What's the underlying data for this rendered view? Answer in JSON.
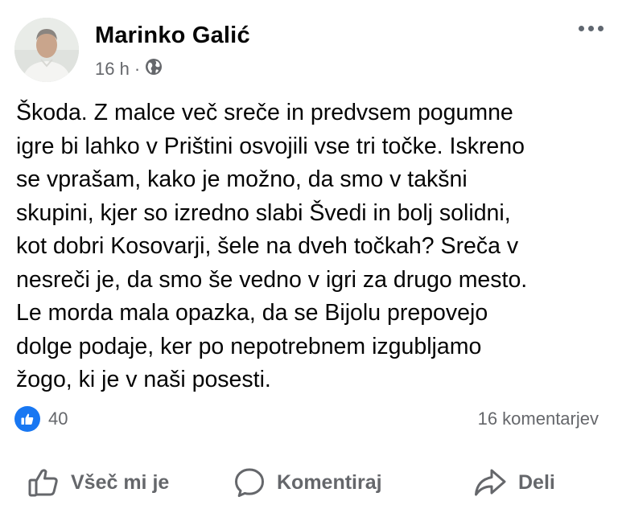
{
  "post": {
    "author": "Marinko Galić",
    "time": "16 h",
    "separator": "·",
    "audience_icon": "globe-icon",
    "more_icon": "more-options-icon",
    "text_lines": [
      "Škoda. Z malce več sreče in predvsem pogumne",
      "igre bi lahko v Prištini osvojili vse tri točke. Iskreno",
      "se vprašam, kako je možno, da smo v takšni",
      "skupini, kjer so izredno slabi Švedi in bolj solidni,",
      "kot dobri Kosovarji, šele na dveh točkah? Sreča v",
      "nesreči je, da smo še vedno v igri za drugo mesto.",
      "Le morda mala opazka, da se Bijolu prepovejo",
      "dolge podaje, ker po nepotrebnem izgubljamo",
      "žogo, ki je v naši posesti."
    ]
  },
  "stats": {
    "likes": "40",
    "comments": "16 komentarjev"
  },
  "actions": {
    "like_label": "Všeč mi je",
    "comment_label": "Komentiraj",
    "share_label": "Deli"
  },
  "colors": {
    "text": "#050505",
    "secondary": "#65676b",
    "like_blue": "#1877f2"
  }
}
